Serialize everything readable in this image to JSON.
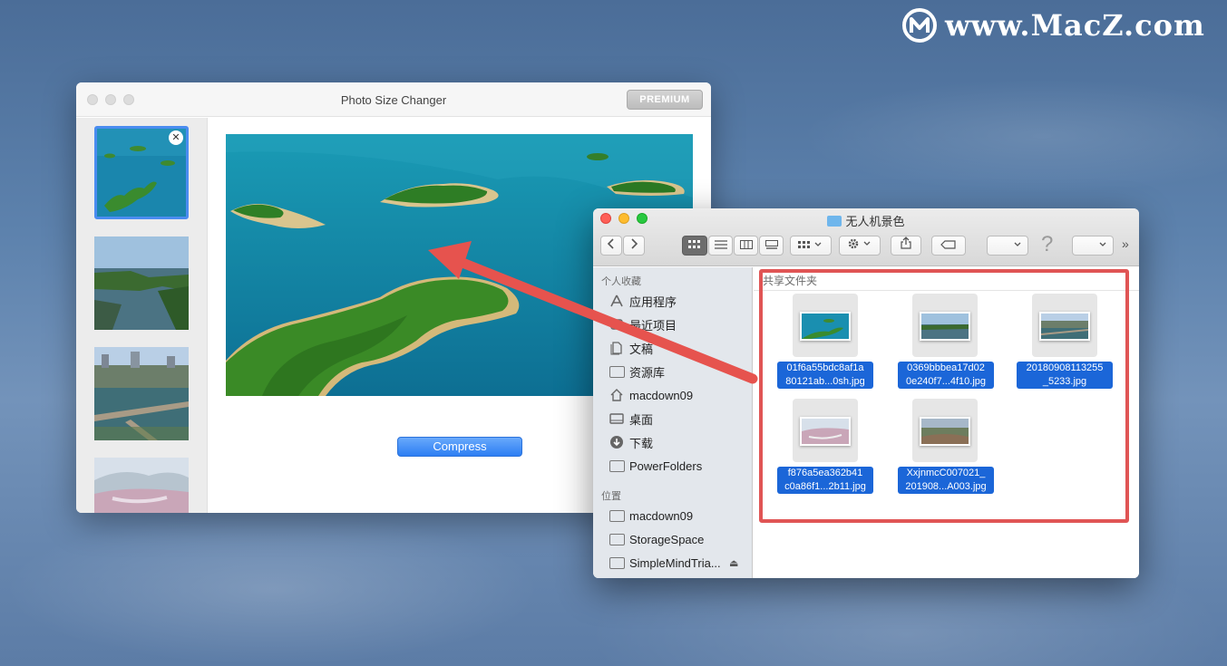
{
  "watermark": {
    "text": "www.MacZ.com"
  },
  "psc": {
    "title": "Photo Size Changer",
    "premium_label": "PREMIUM",
    "remove_glyph": "✕",
    "compress_label": "Compress"
  },
  "finder": {
    "title": "无人机景色",
    "help_glyph": "?",
    "more_glyph": "»",
    "sidebar": {
      "favorites_header": "个人收藏",
      "favorites": [
        {
          "label": "应用程序",
          "icon": "apps-icon"
        },
        {
          "label": "最近项目",
          "icon": "recents-icon"
        },
        {
          "label": "文稿",
          "icon": "documents-icon"
        },
        {
          "label": "资源库",
          "icon": "folder-icon"
        },
        {
          "label": "macdown09",
          "icon": "home-icon"
        },
        {
          "label": "桌面",
          "icon": "desktop-icon"
        },
        {
          "label": "下载",
          "icon": "downloads-icon"
        },
        {
          "label": "PowerFolders",
          "icon": "folder-icon"
        }
      ],
      "locations_header": "位置",
      "locations": [
        {
          "label": "macdown09",
          "icon": "folder-icon"
        },
        {
          "label": "StorageSpace",
          "icon": "folder-icon"
        },
        {
          "label": "SimpleMindTria...",
          "icon": "folder-icon"
        }
      ]
    },
    "content_header": "共享文件夹",
    "files": [
      {
        "line1": "01f6a55bdc8af1a",
        "line2": "80121ab...0sh.jpg"
      },
      {
        "line1": "0369bbbea17d02",
        "line2": "0e240f7...4f10.jpg"
      },
      {
        "line1": "20180908113255",
        "line2": "_5233.jpg"
      },
      {
        "line1": "f876a5ea362b41",
        "line2": "c0a86f1...2b11.jpg"
      },
      {
        "line1": "XxjnmcC007021_",
        "line2": "201908...A003.jpg"
      }
    ]
  },
  "colors": {
    "accent": "#2c7ef3",
    "annotation_red": "#e05555",
    "selection_blue": "#1b66d8"
  }
}
